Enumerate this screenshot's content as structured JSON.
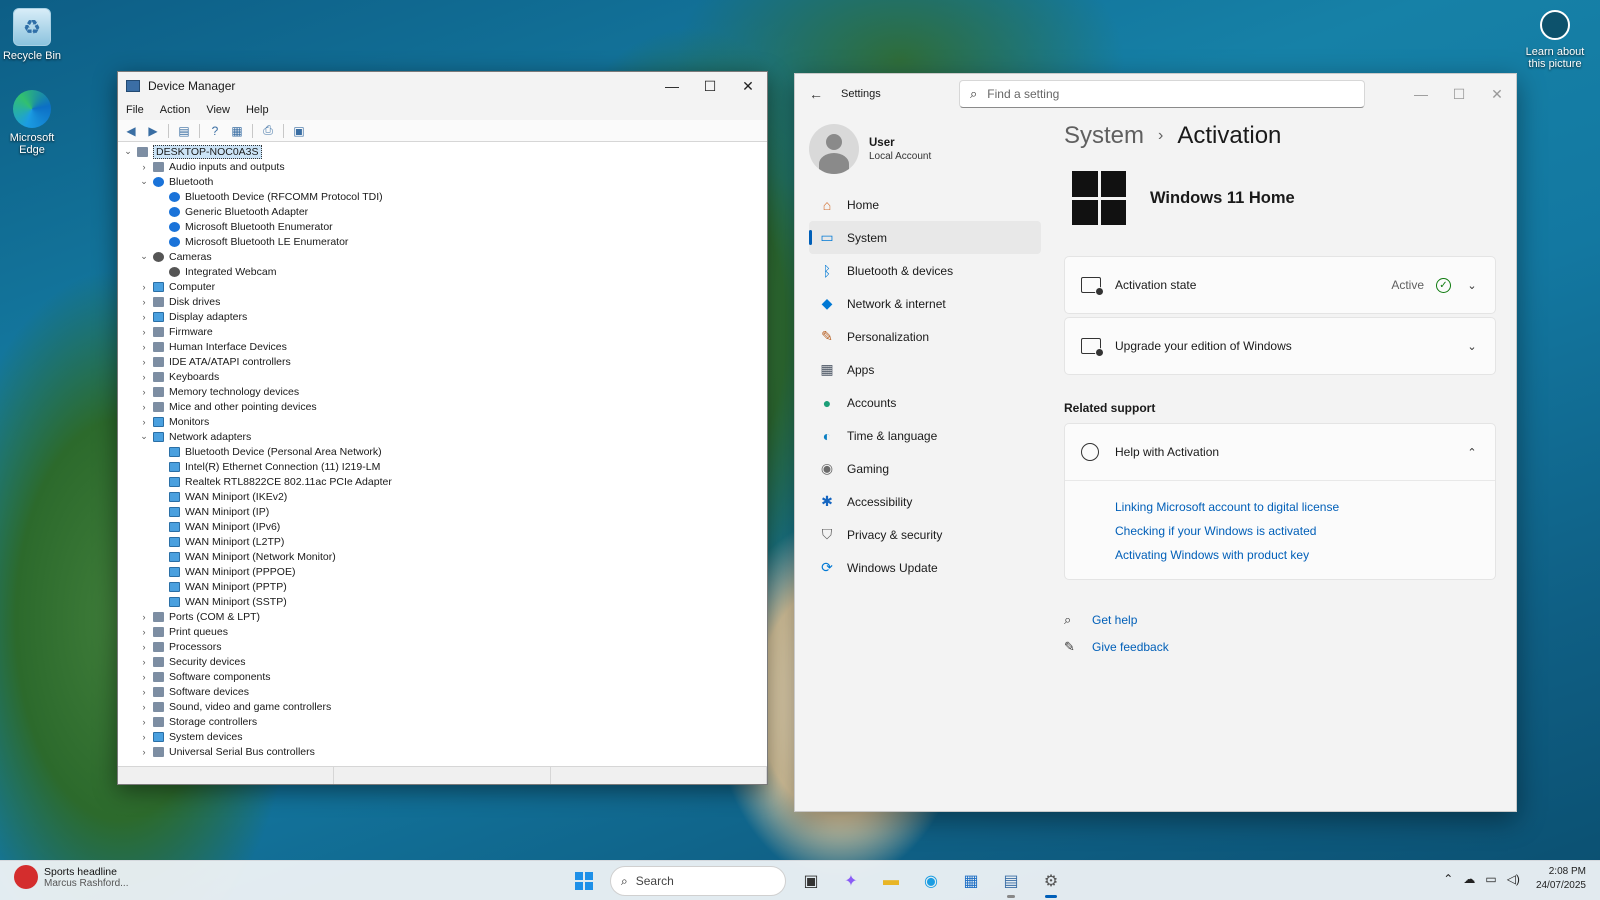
{
  "desktop": {
    "icons": [
      {
        "label": "Recycle Bin"
      },
      {
        "label": "Microsoft Edge"
      },
      {
        "label": "Learn about this picture"
      }
    ]
  },
  "device_manager": {
    "title": "Device Manager",
    "menu": [
      "File",
      "Action",
      "View",
      "Help"
    ],
    "root": "DESKTOP-NOC0A3S",
    "tree": [
      {
        "level": 1,
        "label": "Audio inputs and outputs",
        "expanded": false
      },
      {
        "level": 1,
        "label": "Bluetooth",
        "expanded": true,
        "icon": "bluetooth"
      },
      {
        "level": 2,
        "label": "Bluetooth Device (RFCOMM Protocol TDI)",
        "icon": "bluetooth"
      },
      {
        "level": 2,
        "label": "Generic Bluetooth Adapter",
        "icon": "bluetooth"
      },
      {
        "level": 2,
        "label": "Microsoft Bluetooth Enumerator",
        "icon": "bluetooth"
      },
      {
        "level": 2,
        "label": "Microsoft Bluetooth LE Enumerator",
        "icon": "bluetooth"
      },
      {
        "level": 1,
        "label": "Cameras",
        "expanded": true,
        "icon": "camera"
      },
      {
        "level": 2,
        "label": "Integrated Webcam",
        "icon": "camera"
      },
      {
        "level": 1,
        "label": "Computer",
        "expanded": false,
        "icon": "network"
      },
      {
        "level": 1,
        "label": "Disk drives",
        "expanded": false
      },
      {
        "level": 1,
        "label": "Display adapters",
        "expanded": false,
        "icon": "network"
      },
      {
        "level": 1,
        "label": "Firmware",
        "expanded": false
      },
      {
        "level": 1,
        "label": "Human Interface Devices",
        "expanded": false
      },
      {
        "level": 1,
        "label": "IDE ATA/ATAPI controllers",
        "expanded": false
      },
      {
        "level": 1,
        "label": "Keyboards",
        "expanded": false
      },
      {
        "level": 1,
        "label": "Memory technology devices",
        "expanded": false
      },
      {
        "level": 1,
        "label": "Mice and other pointing devices",
        "expanded": false
      },
      {
        "level": 1,
        "label": "Monitors",
        "expanded": false,
        "icon": "network"
      },
      {
        "level": 1,
        "label": "Network adapters",
        "expanded": true,
        "icon": "network"
      },
      {
        "level": 2,
        "label": "Bluetooth Device (Personal Area Network)",
        "icon": "network"
      },
      {
        "level": 2,
        "label": "Intel(R) Ethernet Connection (11) I219-LM",
        "icon": "network"
      },
      {
        "level": 2,
        "label": "Realtek RTL8822CE 802.11ac PCIe Adapter",
        "icon": "network"
      },
      {
        "level": 2,
        "label": "WAN Miniport (IKEv2)",
        "icon": "network"
      },
      {
        "level": 2,
        "label": "WAN Miniport (IP)",
        "icon": "network"
      },
      {
        "level": 2,
        "label": "WAN Miniport (IPv6)",
        "icon": "network"
      },
      {
        "level": 2,
        "label": "WAN Miniport (L2TP)",
        "icon": "network"
      },
      {
        "level": 2,
        "label": "WAN Miniport (Network Monitor)",
        "icon": "network"
      },
      {
        "level": 2,
        "label": "WAN Miniport (PPPOE)",
        "icon": "network"
      },
      {
        "level": 2,
        "label": "WAN Miniport (PPTP)",
        "icon": "network"
      },
      {
        "level": 2,
        "label": "WAN Miniport (SSTP)",
        "icon": "network"
      },
      {
        "level": 1,
        "label": "Ports (COM & LPT)",
        "expanded": false
      },
      {
        "level": 1,
        "label": "Print queues",
        "expanded": false
      },
      {
        "level": 1,
        "label": "Processors",
        "expanded": false
      },
      {
        "level": 1,
        "label": "Security devices",
        "expanded": false
      },
      {
        "level": 1,
        "label": "Software components",
        "expanded": false
      },
      {
        "level": 1,
        "label": "Software devices",
        "expanded": false
      },
      {
        "level": 1,
        "label": "Sound, video and game controllers",
        "expanded": false
      },
      {
        "level": 1,
        "label": "Storage controllers",
        "expanded": false
      },
      {
        "level": 1,
        "label": "System devices",
        "expanded": false,
        "icon": "network"
      },
      {
        "level": 1,
        "label": "Universal Serial Bus controllers",
        "expanded": false
      }
    ]
  },
  "settings": {
    "app_name": "Settings",
    "search_placeholder": "Find a setting",
    "user": {
      "name": "User",
      "type": "Local Account"
    },
    "nav": [
      {
        "label": "Home",
        "icon": "home-icon",
        "glyph": "⌂",
        "color": "#d26b2b"
      },
      {
        "label": "System",
        "icon": "system-icon",
        "glyph": "▭",
        "color": "#0078d4",
        "active": true
      },
      {
        "label": "Bluetooth & devices",
        "icon": "bluetooth-icon",
        "glyph": "ᛒ",
        "color": "#0078d4"
      },
      {
        "label": "Network & internet",
        "icon": "wifi-icon",
        "glyph": "◆",
        "color": "#0078d4"
      },
      {
        "label": "Personalization",
        "icon": "brush-icon",
        "glyph": "✎",
        "color": "#b65d1f"
      },
      {
        "label": "Apps",
        "icon": "apps-icon",
        "glyph": "▦",
        "color": "#4b5563"
      },
      {
        "label": "Accounts",
        "icon": "accounts-icon",
        "glyph": "●",
        "color": "#1b9e77"
      },
      {
        "label": "Time & language",
        "icon": "globe-clock-icon",
        "glyph": "◐",
        "color": "#0a7fc2"
      },
      {
        "label": "Gaming",
        "icon": "gamepad-icon",
        "glyph": "◉",
        "color": "#6b6b6b"
      },
      {
        "label": "Accessibility",
        "icon": "accessibility-icon",
        "glyph": "✱",
        "color": "#1565c0"
      },
      {
        "label": "Privacy & security",
        "icon": "shield-icon",
        "glyph": "⛉",
        "color": "#5a5a5a"
      },
      {
        "label": "Windows Update",
        "icon": "update-icon",
        "glyph": "⟳",
        "color": "#0078d4"
      }
    ],
    "breadcrumb": {
      "parent": "System",
      "current": "Activation",
      "separator": "›"
    },
    "edition": "Windows 11 Home",
    "activation_state": {
      "label": "Activation state",
      "value": "Active"
    },
    "upgrade": {
      "label": "Upgrade your edition of Windows"
    },
    "related_support": "Related support",
    "help": {
      "title": "Help with Activation",
      "links": [
        "Linking Microsoft account to digital license",
        "Checking if your Windows is activated",
        "Activating Windows with product key"
      ]
    },
    "footer": [
      {
        "label": "Get help",
        "icon": "help-icon"
      },
      {
        "label": "Give feedback",
        "icon": "feedback-icon"
      }
    ]
  },
  "taskbar": {
    "news": {
      "title": "Sports headline",
      "subtitle": "Marcus Rashford..."
    },
    "search_placeholder": "Search",
    "clock": {
      "time": "2:08 PM",
      "date": "24/07/2025"
    }
  }
}
